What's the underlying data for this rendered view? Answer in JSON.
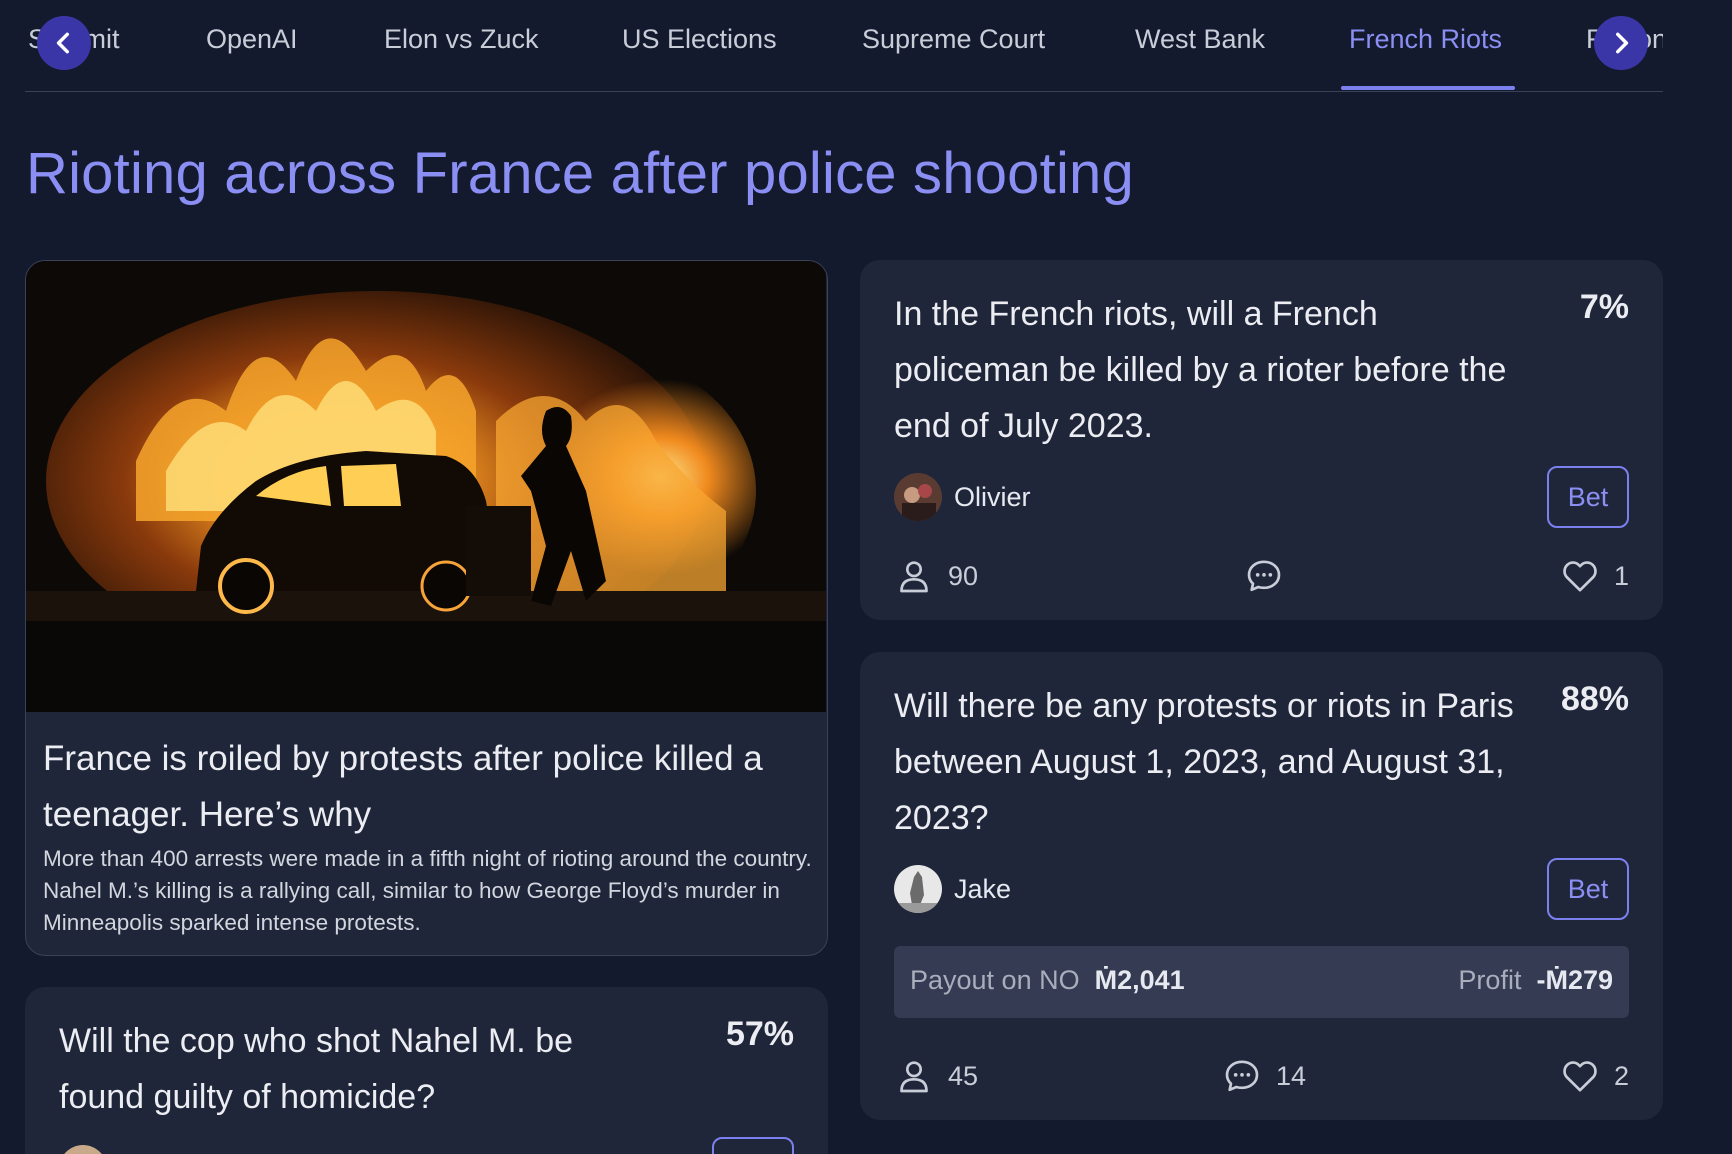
{
  "tabs": [
    {
      "label": "Summit",
      "active": false
    },
    {
      "label": "OpenAI",
      "active": false
    },
    {
      "label": "Elon vs Zuck",
      "active": false
    },
    {
      "label": "US Elections",
      "active": false
    },
    {
      "label": "Supreme Court",
      "active": false
    },
    {
      "label": "West Bank",
      "active": false
    },
    {
      "label": "French Riots",
      "active": true
    },
    {
      "label": "Fusion Power",
      "active": false
    }
  ],
  "page_title": "Rioting across France after police shooting",
  "news": {
    "title": "France is roiled by protests after police killed a teenager. Here’s why",
    "description": "More than 400 arrests were made in a fifth night of rioting around the country. Nahel M.’s killing is a rallying call, similar to how George Floyd’s murder in Minneapolis sparked intense protests."
  },
  "markets": [
    {
      "question": "In the French riots, will a French policeman be killed by a rioter before the end of July 2023.",
      "probability": "7%",
      "creator": "Olivier",
      "bet_label": "Bet",
      "traders": "90",
      "comments": "",
      "likes": "1"
    },
    {
      "question": "Will there be any protests or riots in Paris between August 1, 2023, and August 31, 2023?",
      "probability": "88%",
      "creator": "Jake",
      "bet_label": "Bet",
      "payout_label": "Payout on NO",
      "payout_value": "Ṁ2,041",
      "profit_label": "Profit",
      "profit_value": "-Ṁ279",
      "traders": "45",
      "comments": "14",
      "likes": "2"
    },
    {
      "question": "Will the cop who shot Nahel M. be found guilty of homicide?",
      "probability": "57%"
    }
  ],
  "icons": {
    "prev": "chevron-left-icon",
    "next": "chevron-right-icon",
    "traders": "user-icon",
    "comments": "comment-bubble-icon",
    "likes": "heart-icon"
  },
  "colors": {
    "background": "#131a2e",
    "card": "#1f2639",
    "accent": "#8b8ff3",
    "arrow_button": "#3b36a8"
  }
}
